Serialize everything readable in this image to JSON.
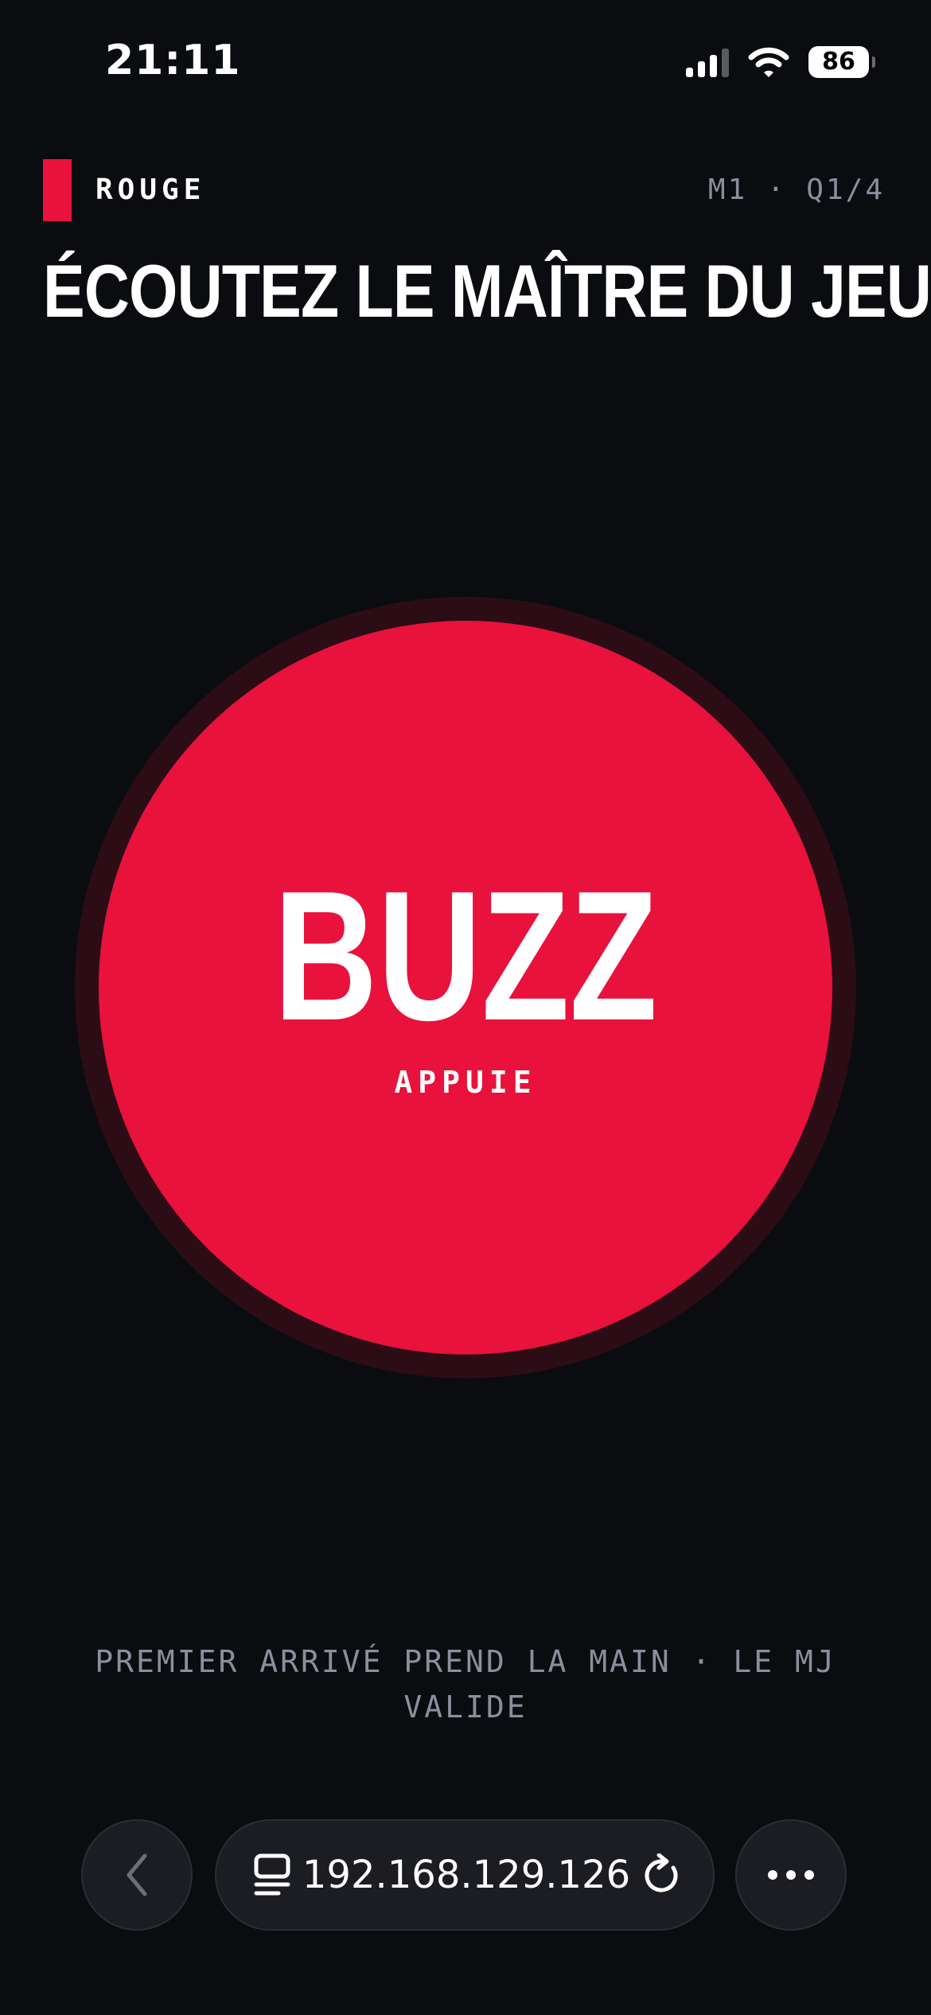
{
  "status_bar": {
    "time": "21:11",
    "battery_level": "86"
  },
  "header": {
    "team_name": "ROUGE",
    "team_color": "#e8123c",
    "round_info": "M1 · Q1/4",
    "title": "ÉCOUTEZ LE MAÎTRE DU JEU"
  },
  "buzzer": {
    "label": "BUZZ",
    "sublabel": "APPUIE",
    "color": "#e8123c"
  },
  "hint": "PREMIER ARRIVÉ PREND LA MAIN · LE MJ VALIDE",
  "browser": {
    "url": "192.168.129.126",
    "icons": [
      "back-chevron-icon",
      "tabs-icon",
      "reload-icon",
      "more-dots-icon"
    ]
  }
}
